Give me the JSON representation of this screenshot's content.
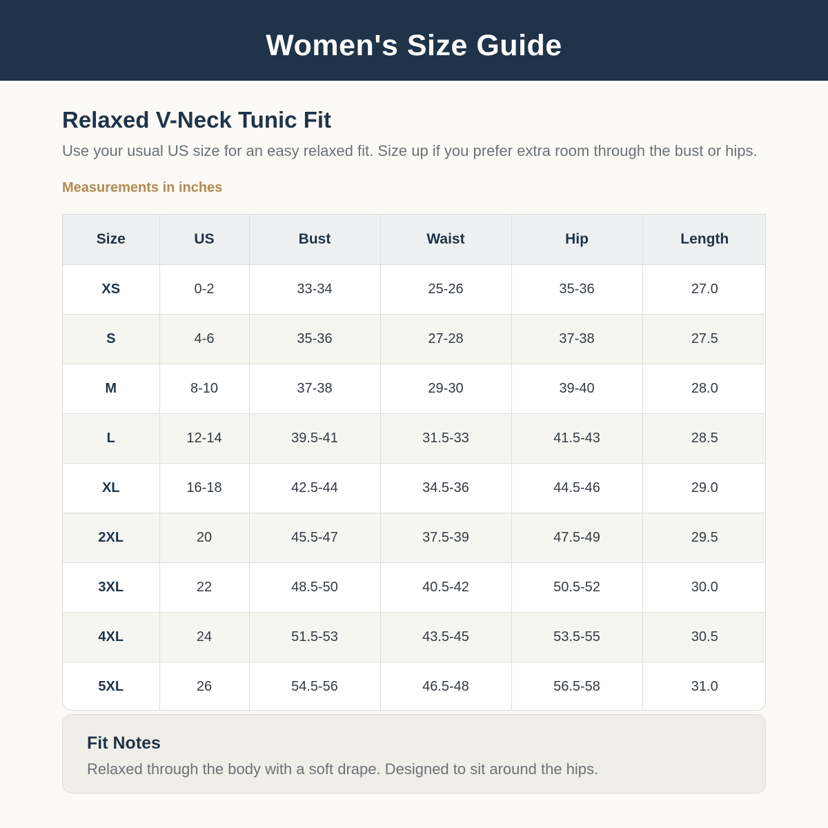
{
  "header": {
    "title": "Women's Size Guide"
  },
  "product": {
    "fit_title": "Relaxed V-Neck Tunic Fit",
    "description": "Use your usual US size for an easy relaxed fit. Size up if you prefer extra room through the bust or hips.",
    "units_label": "Measurements in inches"
  },
  "table": {
    "headers": [
      "Size",
      "US",
      "Bust",
      "Waist",
      "Hip",
      "Length"
    ],
    "rows": [
      [
        "XS",
        "0-2",
        "33-34",
        "25-26",
        "35-36",
        "27.0"
      ],
      [
        "S",
        "4-6",
        "35-36",
        "27-28",
        "37-38",
        "27.5"
      ],
      [
        "M",
        "8-10",
        "37-38",
        "29-30",
        "39-40",
        "28.0"
      ],
      [
        "L",
        "12-14",
        "39.5-41",
        "31.5-33",
        "41.5-43",
        "28.5"
      ],
      [
        "XL",
        "16-18",
        "42.5-44",
        "34.5-36",
        "44.5-46",
        "29.0"
      ],
      [
        "2XL",
        "20",
        "45.5-47",
        "37.5-39",
        "47.5-49",
        "29.5"
      ],
      [
        "3XL",
        "22",
        "48.5-50",
        "40.5-42",
        "50.5-52",
        "30.0"
      ],
      [
        "4XL",
        "24",
        "51.5-53",
        "43.5-45",
        "53.5-55",
        "30.5"
      ],
      [
        "5XL",
        "26",
        "54.5-56",
        "46.5-48",
        "56.5-58",
        "31.0"
      ]
    ]
  },
  "fit_notes": {
    "title": "Fit Notes",
    "text": "Relaxed through the body with a soft drape. Designed to sit around the hips."
  },
  "colors": {
    "header_bg": "#1f3349",
    "accent": "#b18a52",
    "page_bg": "#fbfaf6"
  }
}
